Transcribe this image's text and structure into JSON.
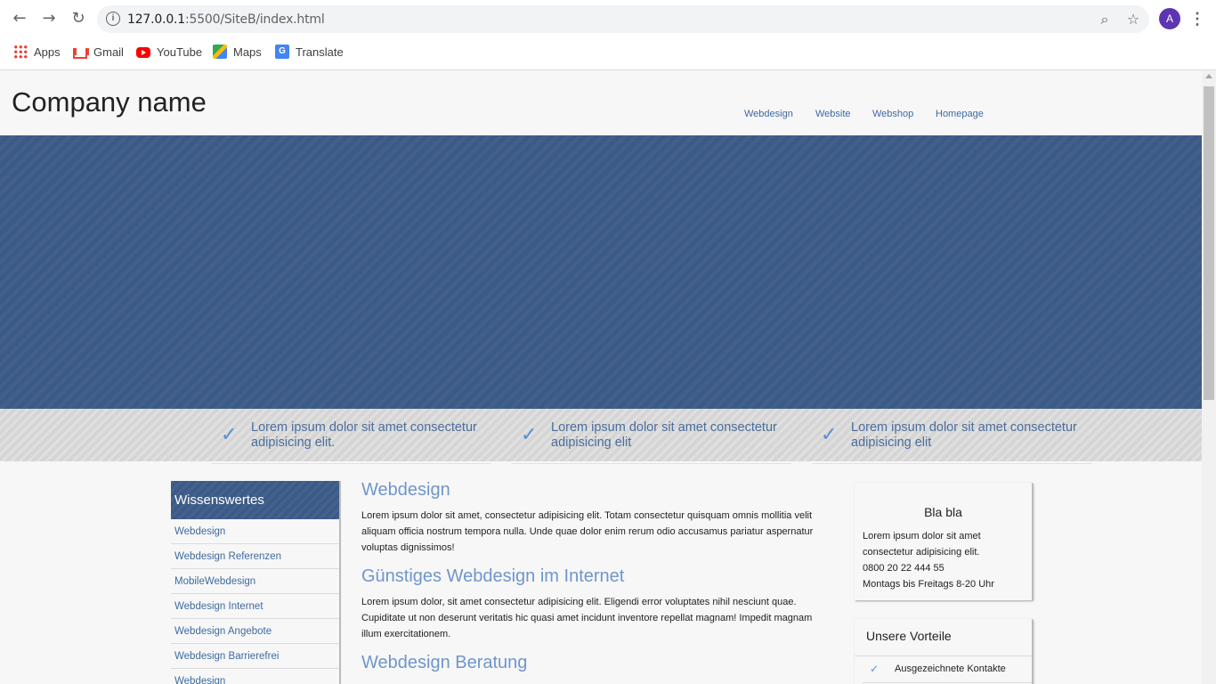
{
  "browser": {
    "url_host": "127.0.0.1",
    "url_rest": ":5500/SiteB/index.html",
    "avatar_letter": "A",
    "bookmarks": [
      {
        "label": "Apps",
        "icon": "apps-icon"
      },
      {
        "label": "Gmail",
        "icon": "gmail-icon"
      },
      {
        "label": "YouTube",
        "icon": "youtube-icon"
      },
      {
        "label": "Maps",
        "icon": "maps-icon"
      },
      {
        "label": "Translate",
        "icon": "translate-icon"
      }
    ]
  },
  "site": {
    "company_name": "Company name",
    "nav": [
      "Webdesign",
      "Website",
      "Webshop",
      "Homepage"
    ],
    "features": [
      "Lorem ipsum dolor sit amet consectetur adipisicing elit.",
      "Lorem ipsum dolor sit amet consectetur adipisicing elit",
      "Lorem ipsum dolor sit amet consectetur adipisicing elit"
    ],
    "sidebar": {
      "title": "Wissenswertes",
      "items": [
        "Webdesign",
        "Webdesign Referenzen",
        "MobileWebdesign",
        "Webdesign Internet",
        "Webdesign Angebote",
        "Webdesign Barrierefrei",
        "Webdesign"
      ]
    },
    "content": [
      {
        "heading": "Webdesign",
        "text": "Lorem ipsum dolor sit amet, consectetur adipisicing elit. Totam consectetur quisquam omnis mollitia velit aliquam officia nostrum tempora nulla. Unde quae dolor enim rerum odio accusamus pariatur aspernatur voluptas dignissimos!"
      },
      {
        "heading": "Günstiges Webdesign im Internet",
        "text": "Lorem ipsum dolor, sit amet consectetur adipisicing elit. Eligendi error voluptates nihil nesciunt quae. Cupiditate ut non deserunt veritatis hic quasi amet incidunt inventore repellat magnam! Impedit magnam illum exercitationem."
      },
      {
        "heading": "Webdesign Beratung",
        "text": ""
      }
    ],
    "box1": {
      "title": "Bla bla",
      "lines": [
        "Lorem ipsum dolor sit amet",
        "consectetur adipisicing elit.",
        "0800 20 22 444 55",
        "Montags bis Freitags 8-20 Uhr"
      ]
    },
    "box2": {
      "title": "Unsere Vorteile",
      "items": [
        "Ausgezeichnete Kontakte"
      ]
    }
  }
}
